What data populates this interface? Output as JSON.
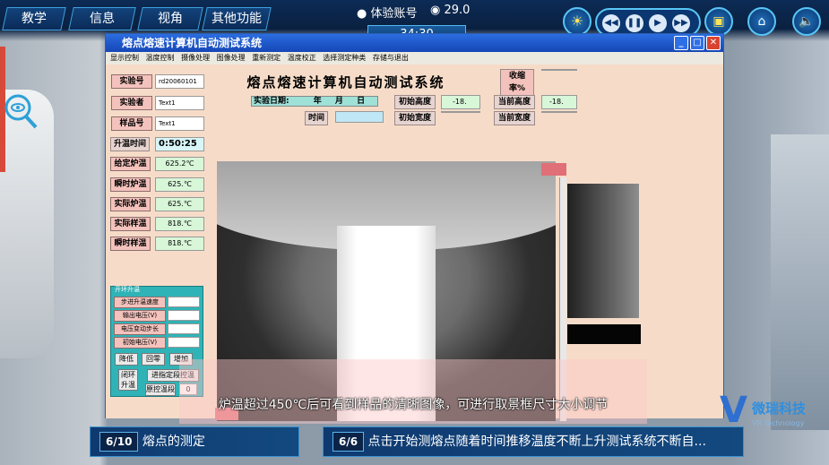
{
  "hud": {
    "menu": [
      "教学",
      "信息",
      "视角",
      "其他功能"
    ],
    "account": "体验账号",
    "score": "29.0",
    "timer": "34:30"
  },
  "window": {
    "title": "熔点熔速计算机自动测试系统",
    "menu": [
      "显示控制",
      "温度控制",
      "摄像处理",
      "图像处理",
      "重新测定",
      "温度校正",
      "选择测定种类",
      "存储与退出"
    ]
  },
  "app": {
    "heading": "熔点熔速计算机自动测试系统",
    "shrink_label": "收缩率%",
    "shrink_value": "",
    "exp_date_label": "实验日期:",
    "year": "年",
    "month": "月",
    "day": "日",
    "time_label": "时间",
    "init_height_label": "初始高度",
    "init_height_value": "-18.",
    "cur_height_label": "当前高度",
    "cur_height_value": "-18.",
    "init_width_label": "初始宽度",
    "init_width_value": "",
    "cur_width_label": "当前宽度",
    "cur_width_value": "",
    "fields": [
      {
        "label": "实验号",
        "value": "rd20060101"
      },
      {
        "label": "实验者",
        "value": "Text1"
      },
      {
        "label": "样品号",
        "value": "Text1"
      }
    ],
    "heat_time_label": "升温时间",
    "heat_time_value": "0:50:25",
    "temps": [
      {
        "label": "给定炉温",
        "value": "625.2℃"
      },
      {
        "label": "瞬时炉温",
        "value": "625.℃"
      },
      {
        "label": "实际炉温",
        "value": "625.℃"
      },
      {
        "label": "实际样温",
        "value": "818.℃"
      },
      {
        "label": "瞬时样温",
        "value": "818.℃"
      }
    ],
    "group_title": "开环升温",
    "group_rows": [
      "步进升温速度",
      "输出电压(V)",
      "电压变动步长",
      "初始电压(V)"
    ],
    "btn_down": "降低",
    "btn_zero": "回零",
    "btn_up": "增加",
    "btn_close_loop": "闭环\n升温",
    "btn_go_setpoint": "进指定段控温",
    "btn_orig_temp": "原控温段",
    "orig_temp_value": "0"
  },
  "subtitle": "炉温超过450℃后可看到样品的清晰图像，可进行取景框尺寸大小调节",
  "steps": [
    {
      "num": "6/10",
      "text": "熔点的测定"
    },
    {
      "num": "6/6",
      "text": "点击开始测熔点随着时间推移温度不断上升测试系统不断自..."
    }
  ],
  "logo": {
    "cn": "微瑞科技",
    "en": "VR Technology"
  },
  "colors": {
    "accent": "#3fa3e0",
    "titlebar": "#1546b6",
    "client": "#f6dcc8"
  }
}
